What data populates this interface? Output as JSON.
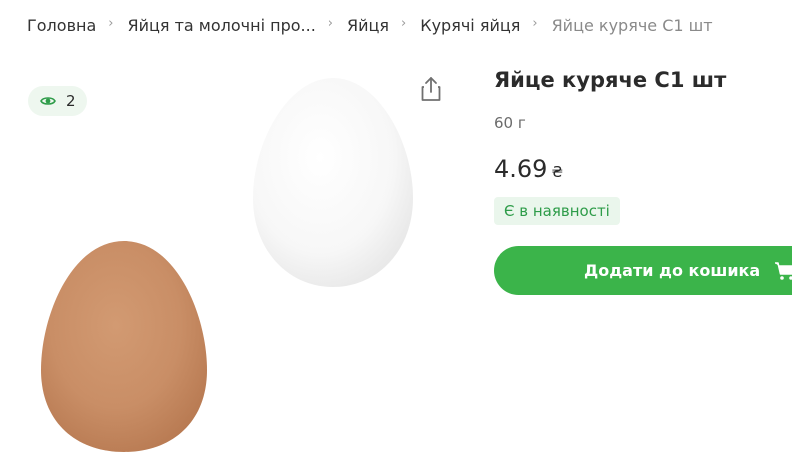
{
  "breadcrumb": {
    "items": [
      {
        "label": "Головна"
      },
      {
        "label": "Яйця та молочні про..."
      },
      {
        "label": "Яйця"
      },
      {
        "label": "Курячі яйця"
      },
      {
        "label": "Яйце куряче С1 шт"
      }
    ]
  },
  "views": {
    "count": "2",
    "icon": "eye-icon"
  },
  "share": {
    "icon": "share-icon"
  },
  "product": {
    "title": "Яйце куряче С1 шт",
    "weight": "60 г",
    "price": "4.69",
    "currency": "₴",
    "stock_status": "Є в наявності"
  },
  "cart_button": {
    "label": "Додати до кошика",
    "icon": "cart-icon"
  },
  "colors": {
    "accent": "#3bb44a",
    "stock_bg": "#eaf6ec",
    "stock_text": "#2e9c49",
    "badge_bg": "#eef7ef"
  }
}
